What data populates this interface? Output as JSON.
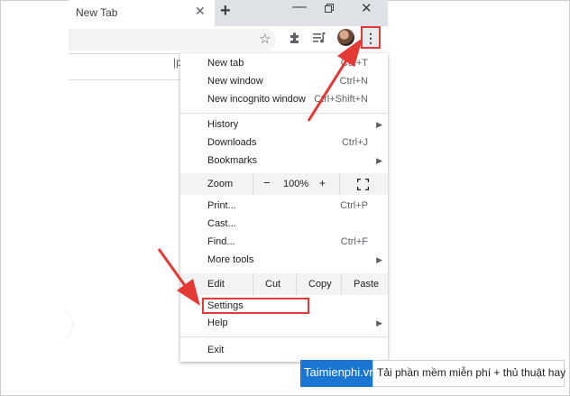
{
  "browser": {
    "tab_title": "New Tab",
    "tab_close": "✕",
    "new_tab": "+",
    "minimize": "—",
    "close": "✕",
    "menu_glyph": "⋮",
    "ntp_search_tail": "|p"
  },
  "menu": {
    "new_tab": {
      "label": "New tab",
      "shortcut": "Ctrl+T"
    },
    "new_window": {
      "label": "New window",
      "shortcut": "Ctrl+N"
    },
    "new_incognito": {
      "label": "New incognito window",
      "shortcut": "Ctrl+Shift+N"
    },
    "history": {
      "label": "History"
    },
    "downloads": {
      "label": "Downloads",
      "shortcut": "Ctrl+J"
    },
    "bookmarks": {
      "label": "Bookmarks"
    },
    "zoom": {
      "label": "Zoom",
      "minus": "−",
      "value": "100%",
      "plus": "+"
    },
    "print": {
      "label": "Print...",
      "shortcut": "Ctrl+P"
    },
    "cast": {
      "label": "Cast..."
    },
    "find": {
      "label": "Find...",
      "shortcut": "Ctrl+F"
    },
    "more_tools": {
      "label": "More tools"
    },
    "edit": {
      "label": "Edit",
      "cut": "Cut",
      "copy": "Copy",
      "paste": "Paste"
    },
    "settings": {
      "label": "Settings"
    },
    "help": {
      "label": "Help"
    },
    "exit": {
      "label": "Exit"
    },
    "submenu_arrow": "▶"
  },
  "icons": {
    "star": "bookmark-star-icon",
    "extensions": "puzzle-icon",
    "media": "media-control-icon",
    "menu": "kebab-menu-icon"
  },
  "colors": {
    "highlight": "#e53935",
    "brand": "#1976d2"
  },
  "watermark": {
    "brand": "Taimienphi.vn",
    "tagline": "Tải phần mềm miễn phí + thủ thuật hay"
  }
}
